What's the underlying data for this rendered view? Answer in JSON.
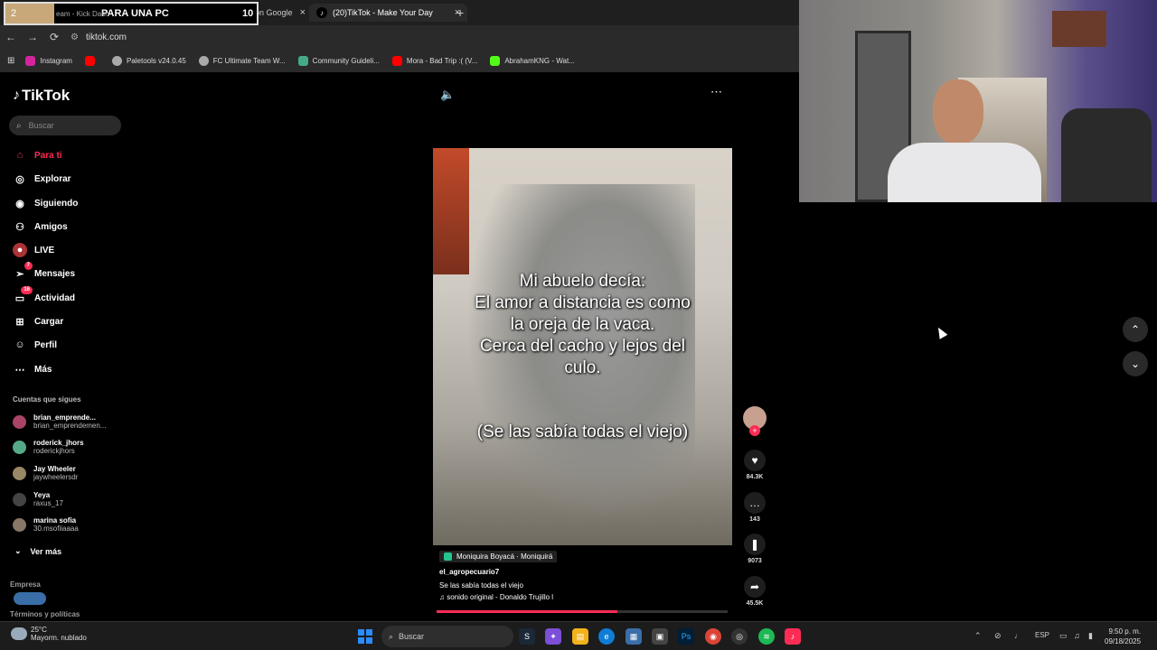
{
  "browser": {
    "overlay": {
      "left_number": "2",
      "text": "PARA UNA PC",
      "right_number": "10"
    },
    "tabs": [
      {
        "label": "eam - Kick Dash",
        "active": false
      },
      {
        "label": "chicago - Buscar con Google",
        "active": false
      },
      {
        "label": "(20)TikTok - Make Your Day",
        "active": true
      }
    ],
    "new_tab": "+",
    "url": "tiktok.com",
    "bookmarks": [
      "Instagram",
      "Paletools v24.0.45",
      "FC Ultimate Team W...",
      "Community Guideli...",
      "Mora - Bad Trip :( (V...",
      "AbrahamKNG - Wat..."
    ]
  },
  "tiktok": {
    "logo": "TikTok",
    "search_placeholder": "Buscar",
    "nav": [
      {
        "label": "Para ti",
        "badge": ""
      },
      {
        "label": "Explorar",
        "badge": ""
      },
      {
        "label": "Siguiendo",
        "badge": ""
      },
      {
        "label": "Amigos",
        "badge": ""
      },
      {
        "label": "LIVE",
        "badge": ""
      },
      {
        "label": "Mensajes",
        "badge": "7"
      },
      {
        "label": "Actividad",
        "badge": "16"
      },
      {
        "label": "Cargar",
        "badge": ""
      },
      {
        "label": "Perfil",
        "badge": ""
      },
      {
        "label": "Más",
        "badge": ""
      }
    ],
    "following_title": "Cuentas que sigues",
    "following": [
      {
        "name": "brian_emprende...",
        "handle": "brian_emprendemen..."
      },
      {
        "name": "roderick_jhors",
        "handle": "roderickjhors"
      },
      {
        "name": "Jay Wheeler",
        "handle": "jaywheelersdr"
      },
      {
        "name": "Yeya",
        "handle": "raxus_17"
      },
      {
        "name": "marina sofia",
        "handle": "30.msofiiaaaa"
      }
    ],
    "see_more": "Ver más",
    "footer": [
      "Empresa",
      "Términos y políticas"
    ],
    "video": {
      "caption": "Mi abuelo decía:\nEl amor a distancia es como\nla oreja de la vaca.\nCerca del cacho y lejos del\nculo.",
      "caption2": "(Se las sabía todas el viejo)",
      "location": "Moniquira Boyacá · Moniquirá",
      "username": "el_agropecuario7",
      "description": "Se las sabía todas el viejo",
      "sound": "♫ sonido original - Donaldo Trujillo l",
      "progress": 0.62,
      "likes": "84.3K",
      "comments": "143",
      "saves": "9073",
      "shares": "45.5K"
    }
  },
  "taskbar": {
    "temperature": "25°C",
    "weather": "Mayorm. nublado",
    "search": "Buscar",
    "language": "ESP",
    "time": "9:50 p. m.",
    "date": "09/18/2025"
  },
  "colors": {
    "accent": "#fe2c55",
    "background": "#000000"
  }
}
